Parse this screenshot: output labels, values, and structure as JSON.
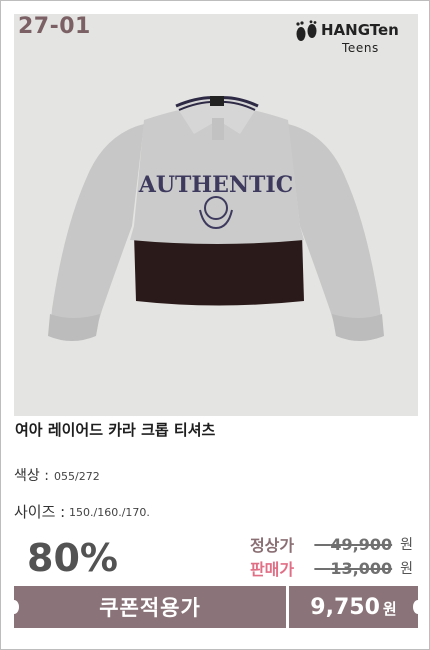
{
  "product": {
    "code": "27-01",
    "brand_name": "HANGTen",
    "brand_sub": "Teens",
    "logo_icon": "footprints-icon",
    "print_text": "AUTHENTIC",
    "title": "여아 레이어드 카라 크롭 티셔츠",
    "color_label": "색상 :",
    "color_value": "055/272",
    "size_label": "사이즈 :",
    "size_value": "150./160./170."
  },
  "pricing": {
    "discount": "80%",
    "regular_label": "정상가",
    "regular_price": "49,900",
    "regular_unit": "원",
    "sale_label": "판매가",
    "sale_price": "13,000",
    "sale_unit": "원",
    "coupon_label": "쿠폰적용가",
    "final_price": "9,750",
    "final_unit": "원"
  },
  "colors": {
    "accent": "#8a7479",
    "sale_label": "#e06f86",
    "code": "#7b6165"
  }
}
